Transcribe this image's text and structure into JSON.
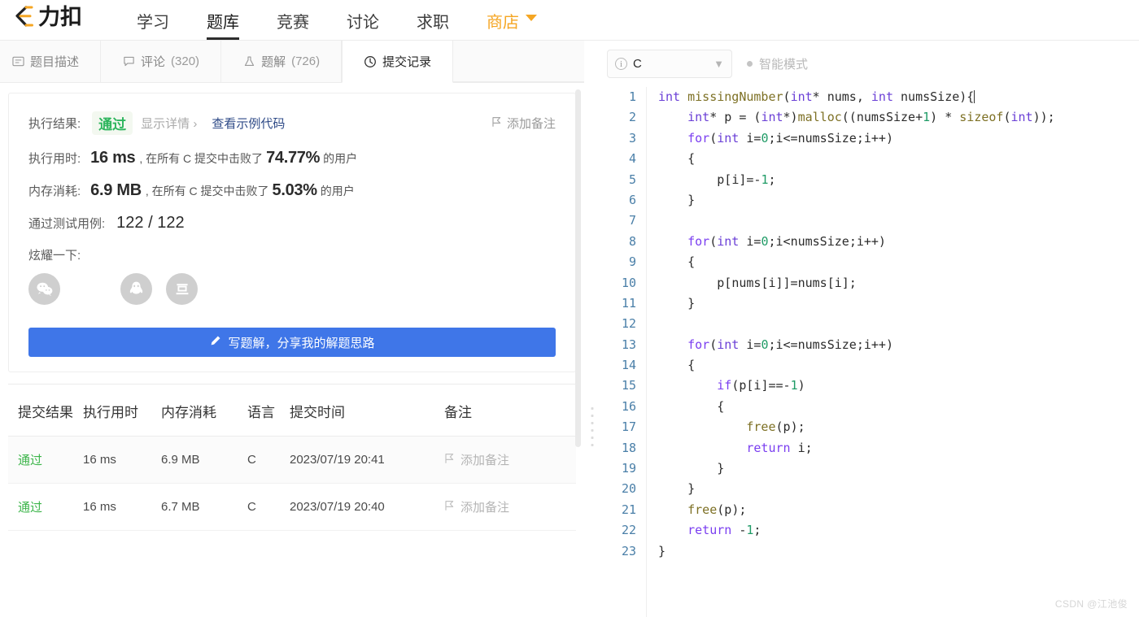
{
  "brand": {
    "logo_text": "力扣",
    "logo_icon": "leetcode-logo-icon"
  },
  "topnav": {
    "items": [
      {
        "label": "学习",
        "active": false
      },
      {
        "label": "题库",
        "active": true
      },
      {
        "label": "竞赛",
        "active": false
      },
      {
        "label": "讨论",
        "active": false
      },
      {
        "label": "求职",
        "active": false
      },
      {
        "label": "商店",
        "active": false,
        "highlight": true
      }
    ]
  },
  "tabs": [
    {
      "label": "题目描述",
      "icon": "description-icon",
      "count": "",
      "active": false
    },
    {
      "label": "评论",
      "icon": "comment-icon",
      "count": "(320)",
      "active": false
    },
    {
      "label": "题解",
      "icon": "flask-icon",
      "count": "(726)",
      "active": false
    },
    {
      "label": "提交记录",
      "icon": "clock-icon",
      "count": "",
      "active": true
    }
  ],
  "result": {
    "exec_result_label": "执行结果:",
    "status": "通过",
    "show_detail": "显示详情 ›",
    "sample_code": "查看示例代码",
    "add_note": "添加备注",
    "runtime_label": "执行用时:",
    "runtime_value": "16 ms",
    "runtime_mid": ", 在所有 C 提交中击败了",
    "runtime_pct": "74.77%",
    "runtime_suffix": "的用户",
    "memory_label": "内存消耗:",
    "memory_value": "6.9 MB",
    "memory_mid": ", 在所有 C 提交中击败了",
    "memory_pct": "5.03%",
    "memory_suffix": "的用户",
    "cases_label": "通过测试用例:",
    "cases_value": "122 / 122",
    "brag_label": "炫耀一下:",
    "share": [
      {
        "name": "wechat-share-icon"
      },
      {
        "name": "qq-share-icon"
      },
      {
        "name": "douban-share-icon"
      }
    ],
    "write_button": "写题解，分享我的解题思路",
    "status_color": "#2db55d",
    "button_color": "#3f76e8"
  },
  "submissions": {
    "headers": [
      "提交结果",
      "执行用时",
      "内存消耗",
      "语言",
      "提交时间",
      "备注"
    ],
    "rows": [
      {
        "result": "通过",
        "runtime": "16 ms",
        "memory": "6.9 MB",
        "lang": "C",
        "time": "2023/07/19 20:41",
        "note": "添加备注"
      },
      {
        "result": "通过",
        "runtime": "16 ms",
        "memory": "6.7 MB",
        "lang": "C",
        "time": "2023/07/19 20:40",
        "note": "添加备注"
      }
    ]
  },
  "editor": {
    "language": "C",
    "smart_mode": "智能模式",
    "line_numbers": [
      "1",
      "2",
      "3",
      "4",
      "5",
      "6",
      "7",
      "8",
      "9",
      "10",
      "11",
      "12",
      "13",
      "14",
      "15",
      "16",
      "17",
      "18",
      "19",
      "20",
      "21",
      "22",
      "23"
    ],
    "code": [
      "int missingNumber(int* nums, int numsSize){",
      "    int* p = (int*)malloc((numsSize+1) * sizeof(int));",
      "    for(int i=0;i<=numsSize;i++)",
      "    {",
      "        p[i]=-1;",
      "    }",
      "",
      "    for(int i=0;i<numsSize;i++)",
      "    {",
      "        p[nums[i]]=nums[i];",
      "    }",
      "",
      "    for(int i=0;i<=numsSize;i++)",
      "    {",
      "        if(p[i]==-1)",
      "        {",
      "            free(p);",
      "            return i;",
      "        }",
      "    }",
      "    free(p);",
      "    return -1;",
      "}"
    ]
  },
  "watermark": "CSDN @江池俊"
}
